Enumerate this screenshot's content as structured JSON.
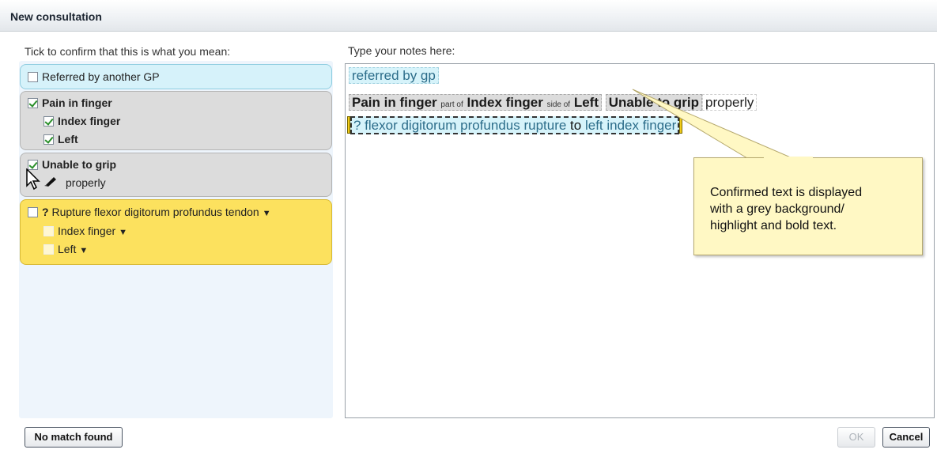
{
  "window": {
    "title": "New consultation"
  },
  "left": {
    "label": "Tick to confirm that this is what you mean:",
    "cards": [
      {
        "color": "cyan",
        "items": [
          {
            "text": "Referred by another GP",
            "checked": false,
            "bold": false
          }
        ]
      },
      {
        "color": "grey",
        "items": [
          {
            "text": "Pain in finger",
            "checked": true,
            "bold": true
          },
          {
            "text": "Index finger",
            "checked": true,
            "bold": true
          },
          {
            "text": "Left",
            "checked": true,
            "bold": true
          }
        ]
      },
      {
        "color": "grey",
        "items": [
          {
            "text": "Unable to grip",
            "checked": true,
            "bold": true
          },
          {
            "text": "properly",
            "checked": false,
            "bold": false
          }
        ]
      },
      {
        "color": "yellow",
        "items": [
          {
            "text": "? Rupture flexor digitorum profundus tendon",
            "checked": false,
            "bold": false
          },
          {
            "text": "Index finger",
            "checked": false,
            "bold": false
          },
          {
            "text": "Left",
            "checked": false,
            "bold": false
          }
        ]
      }
    ]
  },
  "notes": {
    "label": "Type your notes here:",
    "line1": "referred by gp",
    "line2": {
      "pain": "Pain in finger",
      "part_of": "part of",
      "index": "Index finger",
      "side_of": "side of",
      "left": "Left",
      "grip": "Unable to grip",
      "properly": "properly"
    },
    "line3": {
      "flexor": "? flexor digitorum profundus rupture",
      "to": "to",
      "left_index": "left index finger"
    }
  },
  "callout": {
    "line1": "Confirmed text is displayed",
    "line2": "with a grey background/",
    "line3": "highlight and bold text."
  },
  "buttons": {
    "no_match": "No match found",
    "ok": "OK",
    "cancel": "Cancel"
  },
  "icons": [
    "checkbox-icon",
    "cursor-icon",
    "pencil-icon",
    "dropdown-caret-icon"
  ],
  "colors": {
    "cyan": "#d6f2fa",
    "grey": "#dcdcdc",
    "yellow": "#fce15e",
    "callout": "#fff8c4"
  }
}
